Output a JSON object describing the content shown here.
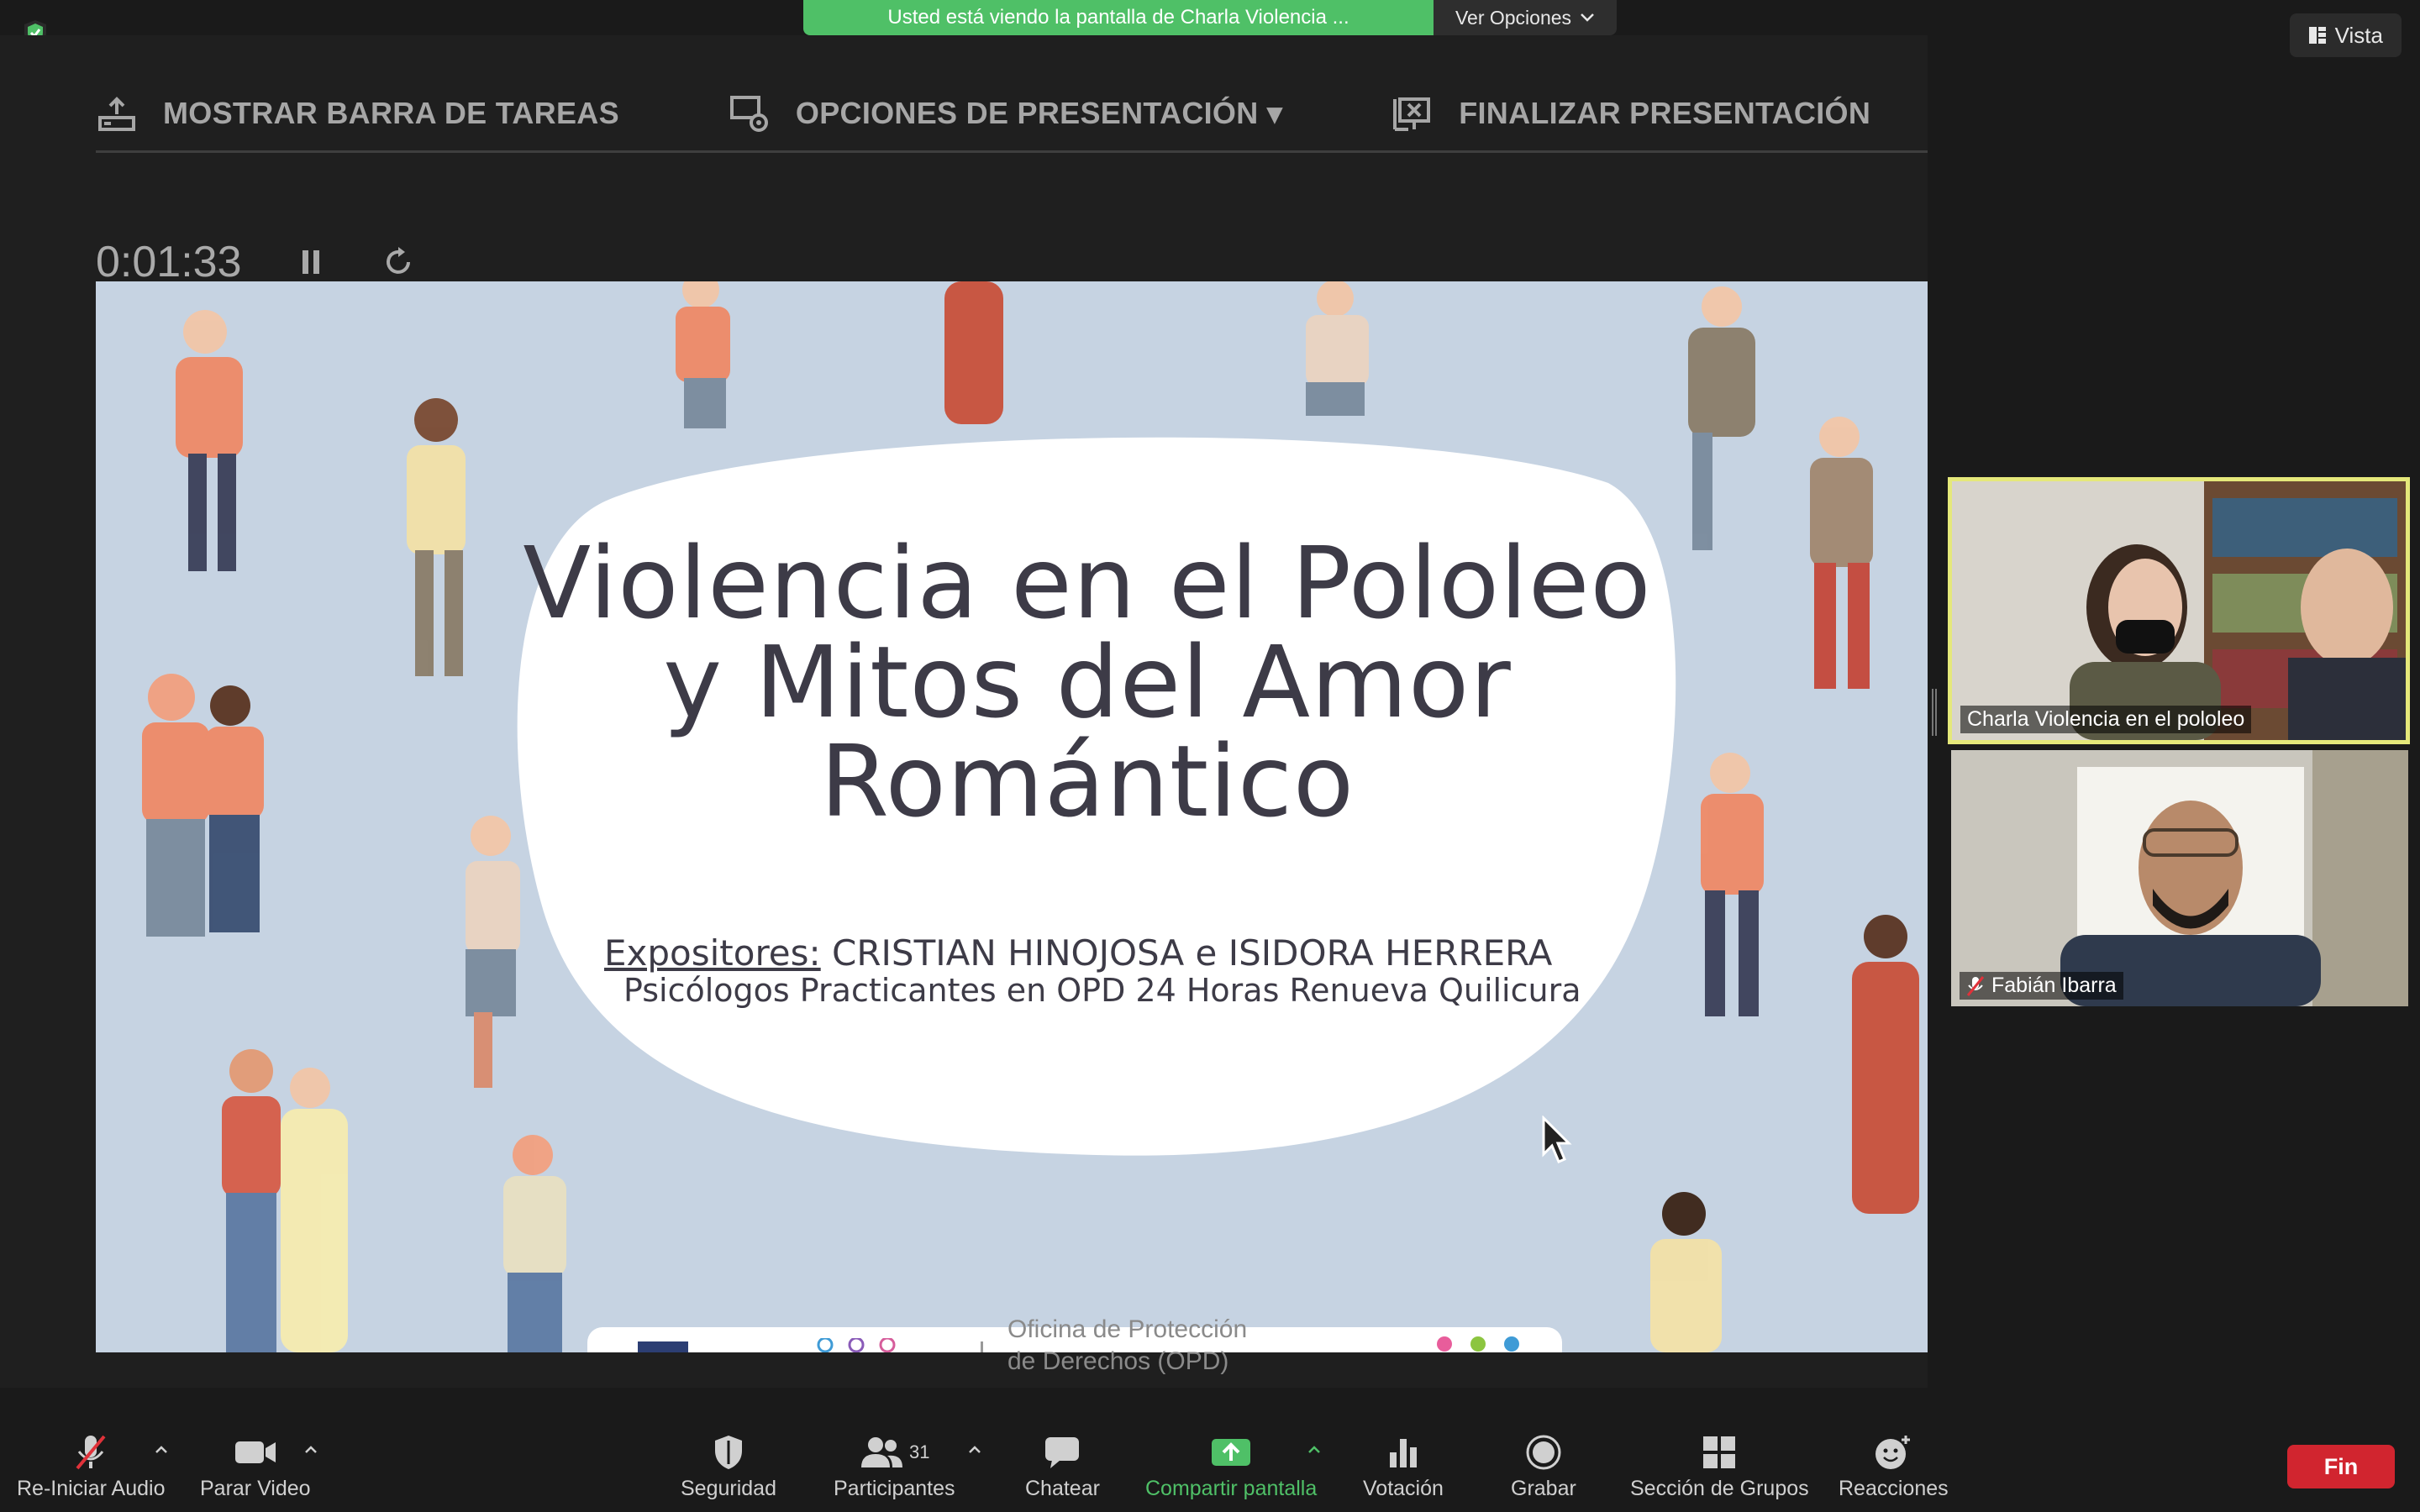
{
  "banner": {
    "sharing_text": "Usted está viendo la pantalla de Charla Violencia ...",
    "options_label": "Ver Opciones",
    "view_label": "Vista"
  },
  "presenter_toolbar": {
    "show_taskbar": "MOSTRAR BARRA DE TAREAS",
    "presentation_options": "OPCIONES DE PRESENTACIÓN ▾",
    "end_presentation": "FINALIZAR PRESENTACIÓN"
  },
  "timer": {
    "elapsed": "0:01:33"
  },
  "slide": {
    "title_lines": [
      "Violencia en el Pololeo",
      "y Mitos del Amor",
      "Romántico"
    ],
    "presenters_label": "Expositores:",
    "presenters_names": " CRISTIAN HINOJOSA e ISIDORA HERRERA",
    "subtitle": "Psicólogos Practicantes en OPD 24 Horas Renueva Quilicura",
    "logo_text_line1": "Oficina de Protección",
    "logo_text_line2": "de Derechos (OPD)"
  },
  "participants": [
    {
      "name": "Charla Violencia en el pololeo",
      "muted": false,
      "active": true
    },
    {
      "name": "Fabián Ibarra",
      "muted": true,
      "active": false
    }
  ],
  "bottom_toolbar": {
    "audio": "Re-Iniciar Audio",
    "video": "Parar Video",
    "security": "Seguridad",
    "participants": "Participantes",
    "participants_count": "31",
    "chat": "Chatear",
    "share": "Compartir pantalla",
    "poll": "Votación",
    "record": "Grabar",
    "breakout": "Sección de Grupos",
    "reactions": "Reacciones",
    "end": "Fin"
  },
  "colors": {
    "share_green": "#4fc067",
    "end_red": "#d1252f",
    "active_speaker": "#e5e87a",
    "slide_bg": "#c6d3e2"
  }
}
